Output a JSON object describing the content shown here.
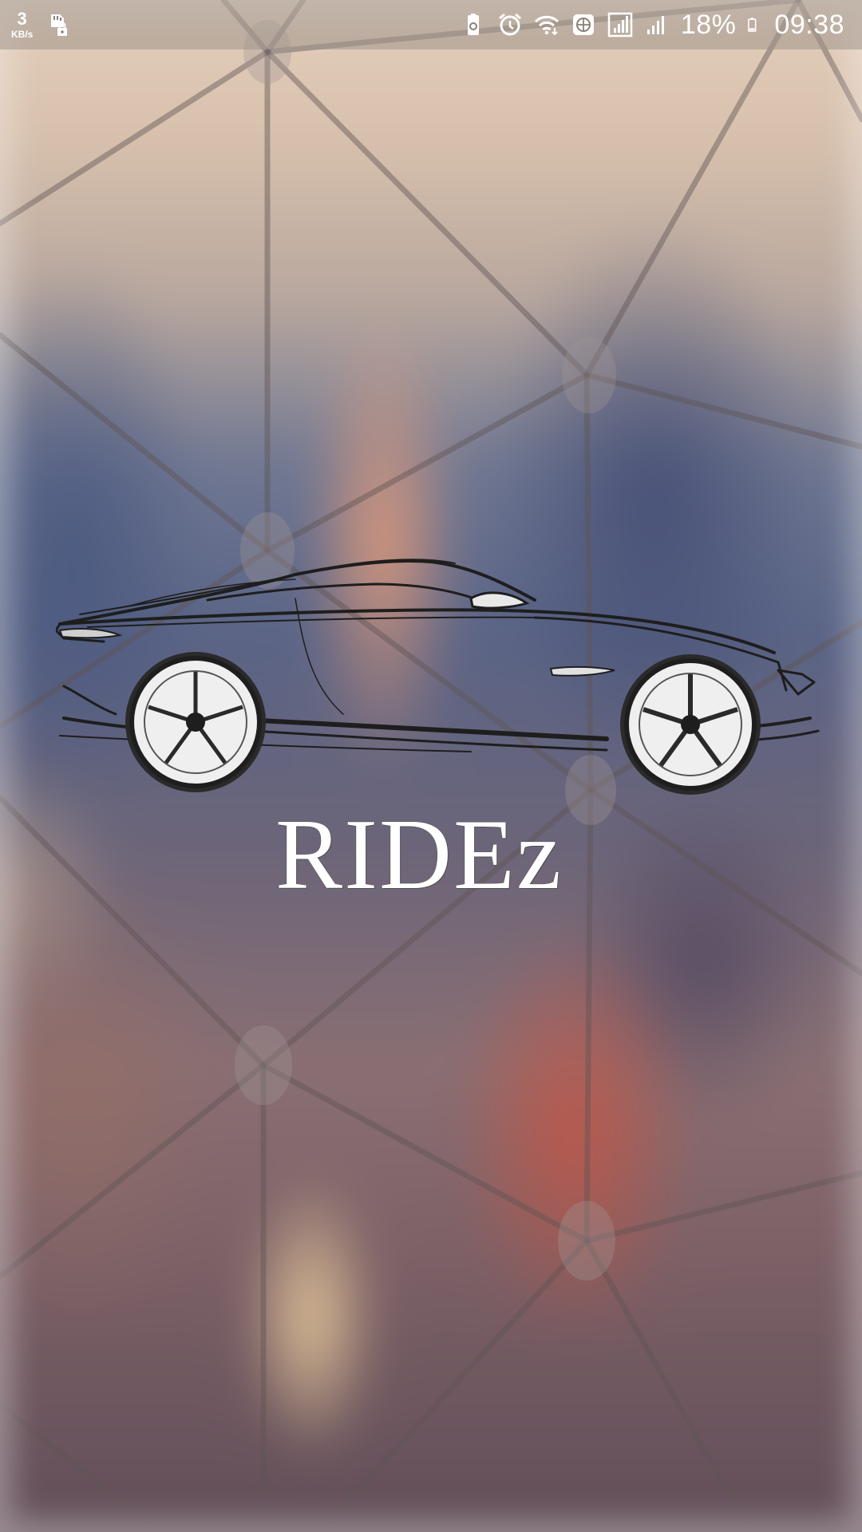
{
  "status_bar": {
    "net_speed_value": "3",
    "net_speed_unit": "KB/s",
    "battery_percent": "18%",
    "time": "09:38",
    "left_icons": [
      "sd-card-icon"
    ],
    "right_icons": [
      "battery-saver-icon",
      "alarm-icon",
      "wifi-icon",
      "globe-icon",
      "signal-icon",
      "signal-icon",
      "battery-icon"
    ]
  },
  "splash": {
    "brand_name": "RIDEz",
    "logo_icon": "car-sketch-icon"
  }
}
